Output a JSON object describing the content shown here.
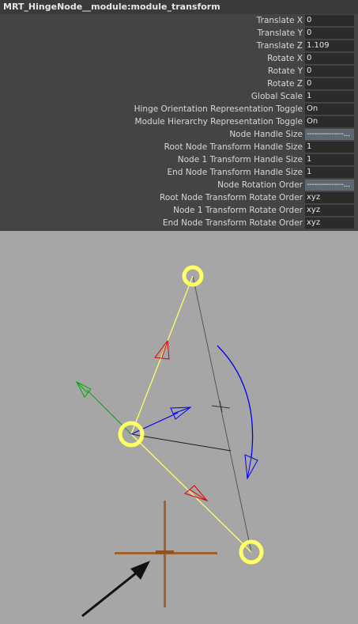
{
  "window": {
    "title": "MRT_HingeNode__module:module_transform"
  },
  "attributes": [
    {
      "label": "Translate X",
      "value": "0"
    },
    {
      "label": "Translate Y",
      "value": "0"
    },
    {
      "label": "Translate Z",
      "value": "1.109"
    },
    {
      "label": "Rotate X",
      "value": "0"
    },
    {
      "label": "Rotate Y",
      "value": "0"
    },
    {
      "label": "Rotate Z",
      "value": "0"
    },
    {
      "label": "Global Scale",
      "value": "1"
    },
    {
      "label": "Hinge Orientation Representation Toggle",
      "value": "On"
    },
    {
      "label": "Module Hierarchy Representation Toggle",
      "value": "On"
    },
    {
      "label": "Node Handle Size",
      "value": "---------------..."
    },
    {
      "label": "Root Node Transform Handle Size",
      "value": "1"
    },
    {
      "label": "Node 1 Transform Handle Size",
      "value": "1"
    },
    {
      "label": "End Node Transform Handle Size",
      "value": "1"
    },
    {
      "label": "Node Rotation Order",
      "value": "---------------..."
    },
    {
      "label": "Root Node Transform Rotate Order",
      "value": "xyz"
    },
    {
      "label": "Node 1 Transform Rotate Order",
      "value": "xyz"
    },
    {
      "label": "End Node Transform Rotate Order",
      "value": "xyz"
    }
  ],
  "colors": {
    "panel_bg": "#444444",
    "viewport_bg": "#a6a6a6",
    "node_ring": "#ffff66",
    "joint_line": "#ffff66",
    "x_axis": "#dd0000",
    "y_axis": "#00aa00",
    "z_axis": "#0000ee",
    "locator": "#a0622d",
    "arrow": "#111111"
  },
  "icons": [
    "node-handle-icon",
    "axis-arrow-icon",
    "rotation-arc-icon",
    "locator-icon",
    "pointer-arrow-icon"
  ]
}
